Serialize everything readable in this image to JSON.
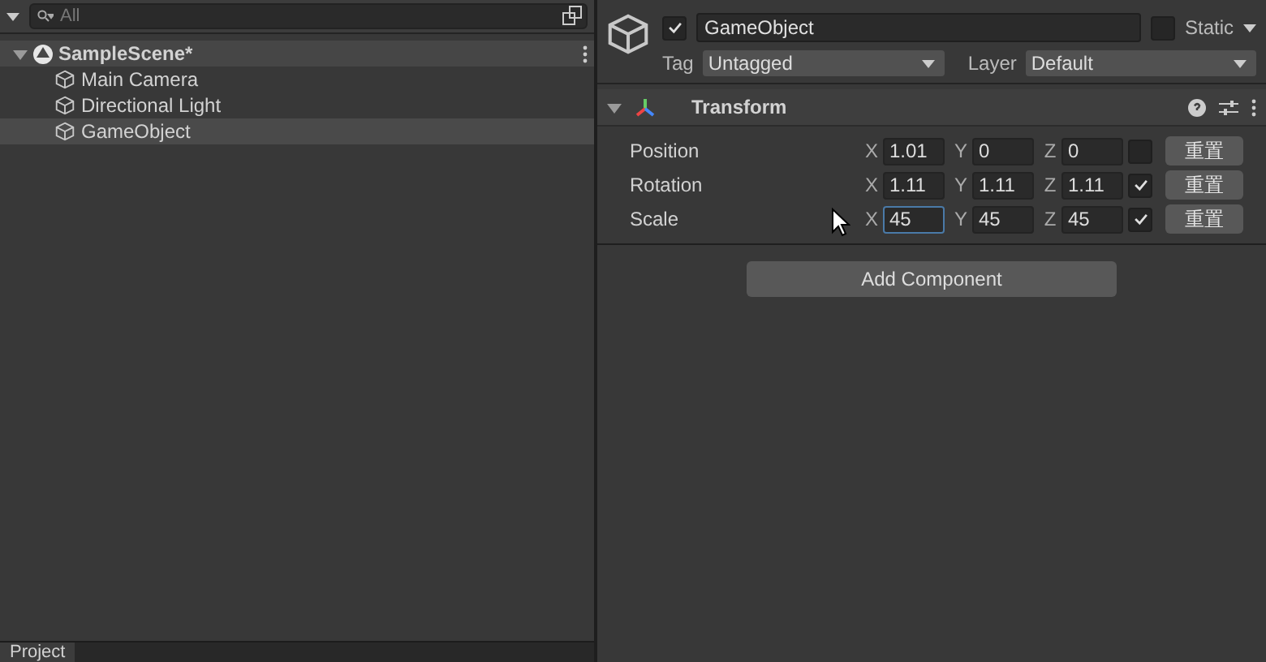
{
  "hierarchy": {
    "search": {
      "placeholder": "All"
    },
    "scene": {
      "label": "SampleScene*",
      "expanded": true,
      "children": [
        {
          "label": "Main Camera",
          "selected": false
        },
        {
          "label": "Directional Light",
          "selected": false
        },
        {
          "label": "GameObject",
          "selected": true
        }
      ]
    }
  },
  "bottom_tab": {
    "label": "Project"
  },
  "inspector": {
    "active": true,
    "name": "GameObject",
    "static": false,
    "static_label": "Static",
    "tag_label": "Tag",
    "tag": "Untagged",
    "layer_label": "Layer",
    "layer": "Default",
    "component": {
      "title": "Transform",
      "expanded": true,
      "rows": [
        {
          "label": "Position",
          "fields": [
            {
              "axis": "X",
              "value": "1.01",
              "selected": false
            },
            {
              "axis": "Y",
              "value": "0",
              "selected": false
            },
            {
              "axis": "Z",
              "value": "0",
              "selected": false
            }
          ],
          "checked": false,
          "button": "重置"
        },
        {
          "label": "Rotation",
          "fields": [
            {
              "axis": "X",
              "value": "1.11",
              "selected": false
            },
            {
              "axis": "Y",
              "value": "1.11",
              "selected": false
            },
            {
              "axis": "Z",
              "value": "1.11",
              "selected": false
            }
          ],
          "checked": true,
          "button": "重置"
        },
        {
          "label": "Scale",
          "fields": [
            {
              "axis": "X",
              "value": "45",
              "selected": true
            },
            {
              "axis": "Y",
              "value": "45",
              "selected": false
            },
            {
              "axis": "Z",
              "value": "45",
              "selected": false
            }
          ],
          "checked": true,
          "button": "重置"
        }
      ]
    },
    "add_button": "Add Component"
  }
}
